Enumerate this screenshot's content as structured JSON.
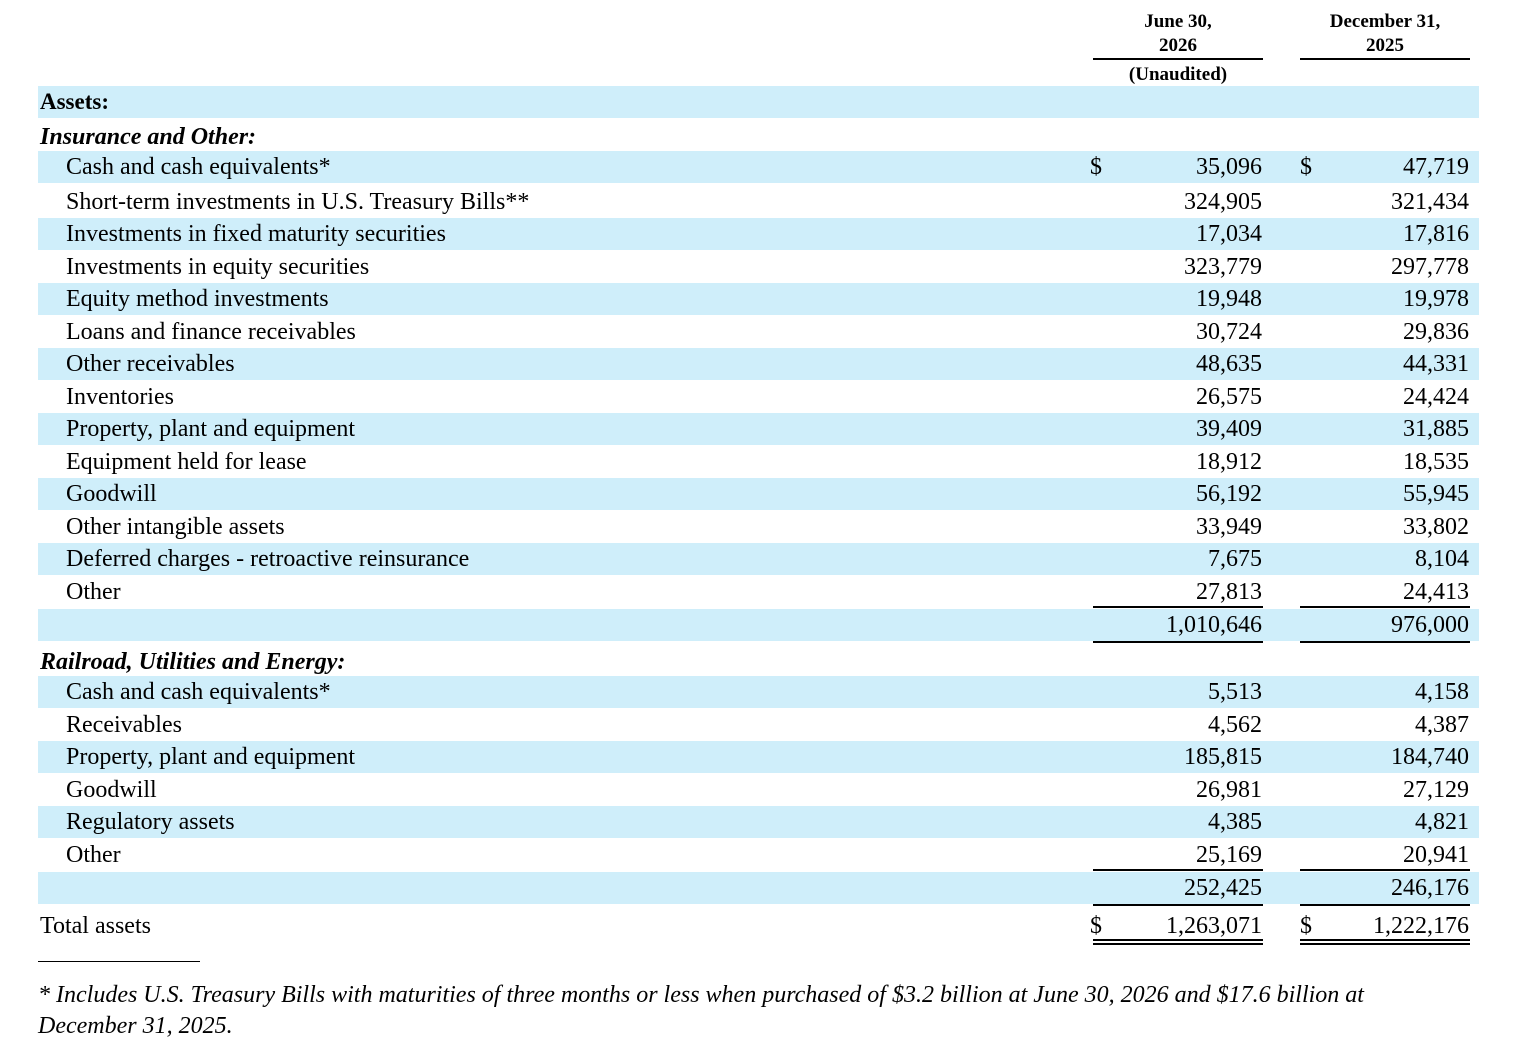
{
  "columns": {
    "col1": {
      "line1": "June 30,",
      "line2": "2026",
      "note": "(Unaudited)"
    },
    "col2": {
      "line1": "December 31,",
      "line2": "2025"
    }
  },
  "currency_symbol": "$",
  "sections": {
    "assets_heading": "Assets:",
    "insurance_heading": "Insurance and Other:",
    "railroad_heading": "Railroad, Utilities and Energy:"
  },
  "insurance_items": [
    {
      "label": "Cash and cash equivalents*",
      "jun_2026": "35,096",
      "dec_2025": "47,719"
    },
    {
      "label": "Short-term investments in U.S. Treasury Bills**",
      "jun_2026": "324,905",
      "dec_2025": "321,434"
    },
    {
      "label": "Investments in fixed maturity securities",
      "jun_2026": "17,034",
      "dec_2025": "17,816"
    },
    {
      "label": "Investments in equity securities",
      "jun_2026": "323,779",
      "dec_2025": "297,778"
    },
    {
      "label": "Equity method investments",
      "jun_2026": "19,948",
      "dec_2025": "19,978"
    },
    {
      "label": "Loans and finance receivables",
      "jun_2026": "30,724",
      "dec_2025": "29,836"
    },
    {
      "label": "Other receivables",
      "jun_2026": "48,635",
      "dec_2025": "44,331"
    },
    {
      "label": "Inventories",
      "jun_2026": "26,575",
      "dec_2025": "24,424"
    },
    {
      "label": "Property, plant and equipment",
      "jun_2026": "39,409",
      "dec_2025": "31,885"
    },
    {
      "label": "Equipment held for lease",
      "jun_2026": "18,912",
      "dec_2025": "18,535"
    },
    {
      "label": "Goodwill",
      "jun_2026": "56,192",
      "dec_2025": "55,945"
    },
    {
      "label": "Other intangible assets",
      "jun_2026": "33,949",
      "dec_2025": "33,802"
    },
    {
      "label": "Deferred charges - retroactive reinsurance",
      "jun_2026": "7,675",
      "dec_2025": "8,104"
    },
    {
      "label": "Other",
      "jun_2026": "27,813",
      "dec_2025": "24,413"
    }
  ],
  "insurance_subtotal": {
    "jun_2026": "1,010,646",
    "dec_2025": "976,000"
  },
  "railroad_items": [
    {
      "label": "Cash and cash equivalents*",
      "jun_2026": "5,513",
      "dec_2025": "4,158"
    },
    {
      "label": "Receivables",
      "jun_2026": "4,562",
      "dec_2025": "4,387"
    },
    {
      "label": "Property, plant and equipment",
      "jun_2026": "185,815",
      "dec_2025": "184,740"
    },
    {
      "label": "Goodwill",
      "jun_2026": "26,981",
      "dec_2025": "27,129"
    },
    {
      "label": "Regulatory assets",
      "jun_2026": "4,385",
      "dec_2025": "4,821"
    },
    {
      "label": "Other",
      "jun_2026": "25,169",
      "dec_2025": "20,941"
    }
  ],
  "railroad_subtotal": {
    "jun_2026": "252,425",
    "dec_2025": "246,176"
  },
  "total": {
    "label": "Total assets",
    "jun_2026": "1,263,071",
    "dec_2025": "1,222,176"
  },
  "footnote": "* Includes U.S. Treasury Bills with maturities of three months or less when purchased of $3.2 billion at June 30, 2026 and $17.6 billion at December 31, 2025."
}
